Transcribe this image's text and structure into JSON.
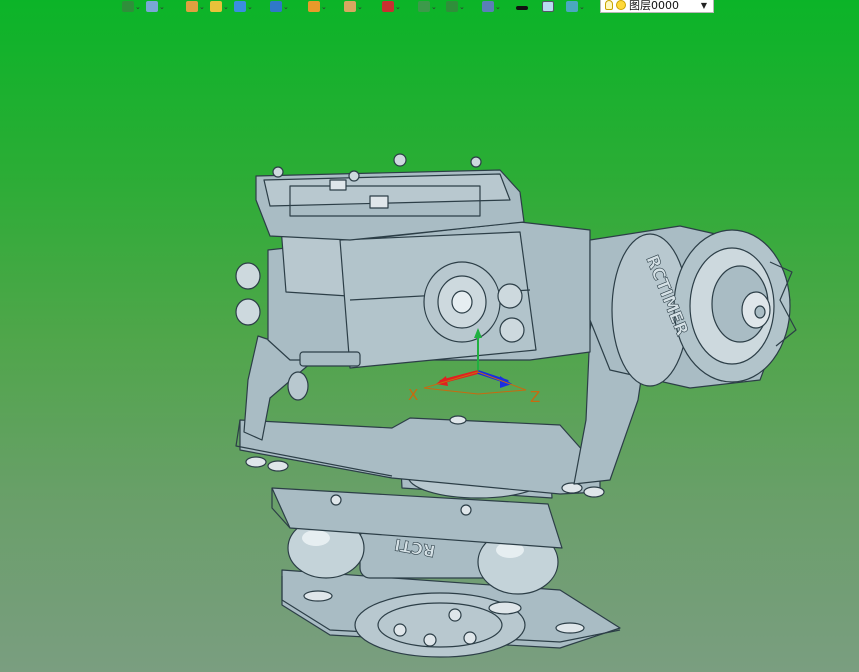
{
  "toolbar": {
    "buttons": [
      {
        "name": "layer-manager-icon",
        "color": "#2f8f3a"
      },
      {
        "name": "light-bulb-icon",
        "color": "#7aa7d6"
      },
      {
        "name": "pencil-icon",
        "color": "#e0a040"
      },
      {
        "name": "cube-yellow-icon",
        "color": "#e8c23a"
      },
      {
        "name": "cube-blue-icon",
        "color": "#3a8ee0"
      },
      {
        "name": "cube-stack-icon",
        "color": "#2f78c8"
      },
      {
        "name": "wheel-icon",
        "color": "#e89a2a"
      },
      {
        "name": "magnifier-icon",
        "color": "#d7a760"
      },
      {
        "name": "crosshair-icon",
        "color": "#c83030"
      },
      {
        "name": "document-icon",
        "color": "#3c9a4a"
      },
      {
        "name": "frame-icon",
        "color": "#2f8f3a"
      },
      {
        "name": "monitor-icon",
        "color": "#5a7fb8"
      },
      {
        "name": "line-color-icon",
        "color": "#111111"
      },
      {
        "name": "fill-color-icon",
        "color": "#b7dcf0"
      },
      {
        "name": "layer-stack-icon",
        "color": "#4aa8c0"
      }
    ],
    "layer_select": {
      "value": "图层0000"
    }
  },
  "viewport": {
    "background_top": "#0bb428",
    "background_bottom": "#7a9e80",
    "model_color": "#a9bcc4",
    "model_edge_color": "#2c3e47",
    "motor_label": "RCTIMER",
    "base_label": "RCTI",
    "axes": {
      "x_label": "X",
      "z_label": "Z",
      "x_color": "#e02020",
      "y_color": "#20b040",
      "z_color": "#1a2ee0",
      "label_color": "#c86a10"
    }
  }
}
